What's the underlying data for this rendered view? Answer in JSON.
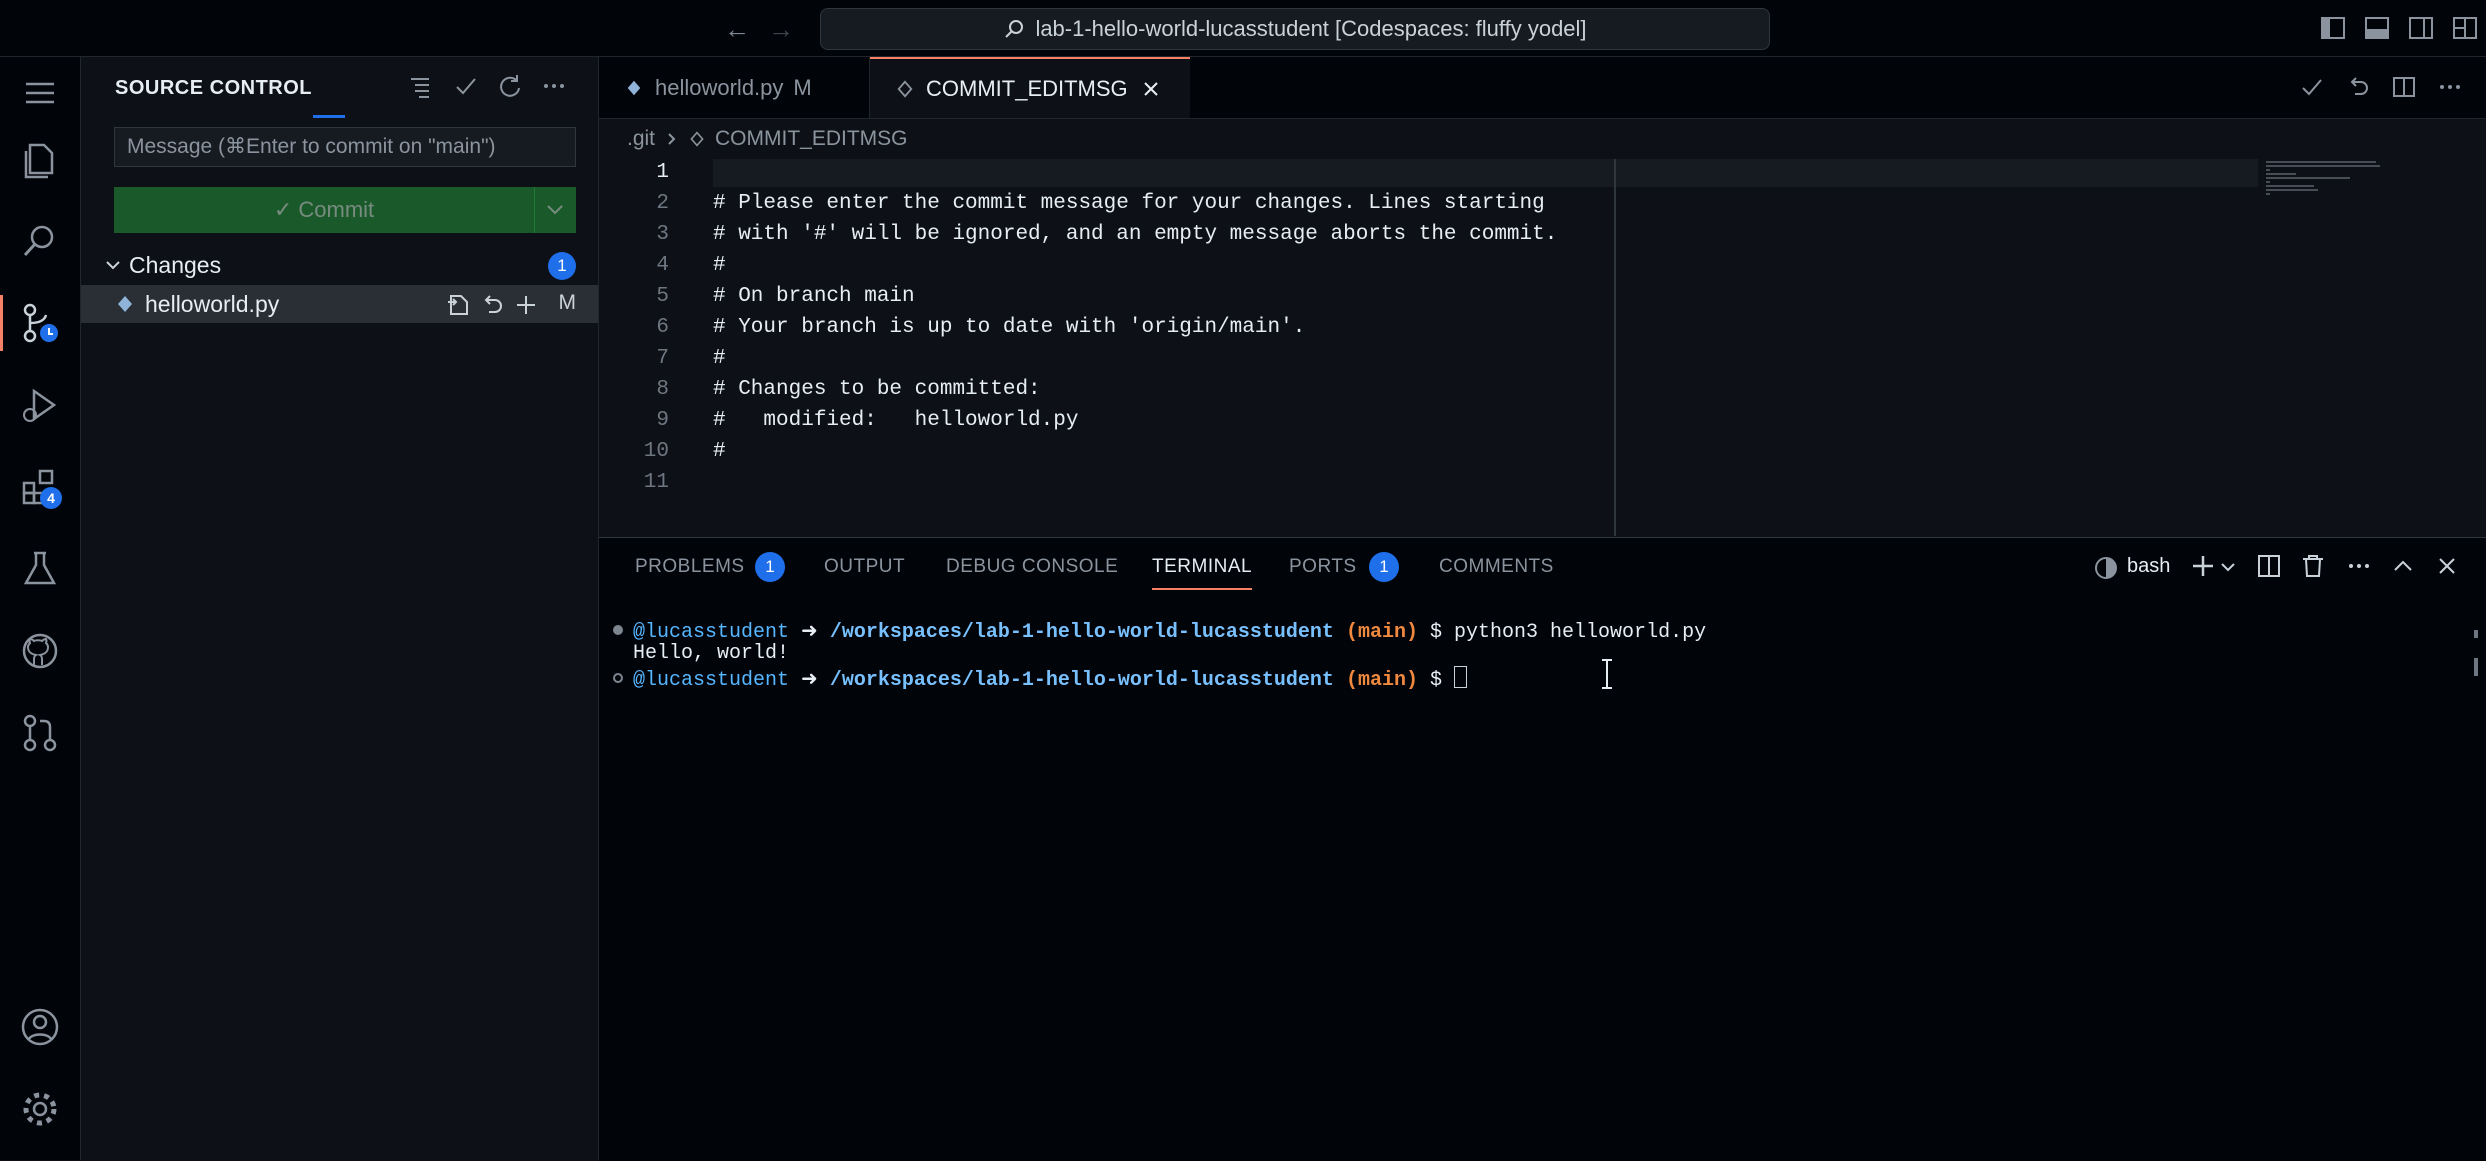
{
  "titlebar": {
    "back": "←",
    "forward": "→",
    "search_text": "lab-1-hello-world-lucasstudent [Codespaces: fluffy yodel]"
  },
  "activity": {
    "extensions_badge": "4"
  },
  "sidebar": {
    "title": "SOURCE CONTROL",
    "message_placeholder": "Message (⌘Enter to commit on \"main\")",
    "commit_label": "✓ Commit",
    "changes_label": "Changes",
    "changes_count": "1",
    "file": {
      "name": "helloworld.py",
      "status": "M"
    }
  },
  "tabs": [
    {
      "label": "helloworld.py",
      "mark": "M"
    },
    {
      "label": "COMMIT_EDITMSG"
    }
  ],
  "breadcrumb": {
    "folder": ".git",
    "file": "COMMIT_EDITMSG"
  },
  "editor": {
    "lines": [
      {
        "n": "1",
        "text": ""
      },
      {
        "n": "2",
        "text": "# Please enter the commit message for your changes. Lines starting"
      },
      {
        "n": "3",
        "text": "# with '#' will be ignored, and an empty message aborts the commit."
      },
      {
        "n": "4",
        "text": "#"
      },
      {
        "n": "5",
        "text": "# On branch main"
      },
      {
        "n": "6",
        "text": "# Your branch is up to date with 'origin/main'."
      },
      {
        "n": "7",
        "text": "#"
      },
      {
        "n": "8",
        "text": "# Changes to be committed:"
      },
      {
        "n": "9",
        "text": "#   modified:   helloworld.py"
      },
      {
        "n": "10",
        "text": "#"
      },
      {
        "n": "11",
        "text": ""
      }
    ]
  },
  "panel": {
    "tabs": {
      "problems": "PROBLEMS",
      "problems_count": "1",
      "output": "OUTPUT",
      "debug": "DEBUG CONSOLE",
      "terminal": "TERMINAL",
      "ports": "PORTS",
      "ports_count": "1",
      "comments": "COMMENTS"
    },
    "shell": "bash"
  },
  "terminal": {
    "user": "@lucasstudent",
    "arrow": "➜",
    "path": "/workspaces/lab-1-hello-world-lucasstudent",
    "branch_open": "(",
    "branch": "main",
    "branch_close": ")",
    "prompt": "$",
    "command": "python3 helloworld.py",
    "output": "Hello, world!"
  },
  "colors": {
    "accent": "#f78166",
    "badge": "#1f6feb",
    "commit_button": "#238636"
  }
}
